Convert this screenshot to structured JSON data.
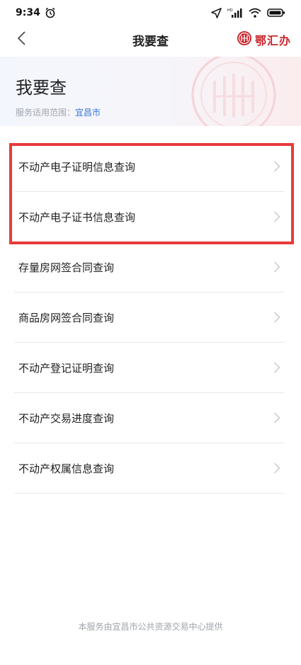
{
  "status_bar": {
    "time": "9:34",
    "alarm_icon": "alarm-icon",
    "location_icon": "location-arrow-icon",
    "signal_icon": "signal-icon",
    "signal_tag": "HD",
    "wifi_icon": "wifi-icon",
    "battery_icon": "battery-icon"
  },
  "nav": {
    "back_icon": "chevron-left-icon",
    "title": "我要查",
    "brand_name": "鄂汇办",
    "brand_icon": "eh-logo-icon"
  },
  "banner": {
    "title": "我要查",
    "scope_label": "服务适用范围：",
    "scope_city": "宜昌市"
  },
  "services": [
    {
      "label": "不动产电子证明信息查询"
    },
    {
      "label": "不动产电子证书信息查询"
    },
    {
      "label": "存量房网签合同查询"
    },
    {
      "label": "商品房网签合同查询"
    },
    {
      "label": "不动产登记证明查询"
    },
    {
      "label": "不动产交易进度查询"
    },
    {
      "label": "不动产权属信息查询"
    }
  ],
  "footer": {
    "text": "本服务由宜昌市公共资源交易中心提供"
  },
  "colors": {
    "brand_red": "#c8262c",
    "link_blue": "#3c78d8",
    "highlight_red": "#e83a3a"
  }
}
